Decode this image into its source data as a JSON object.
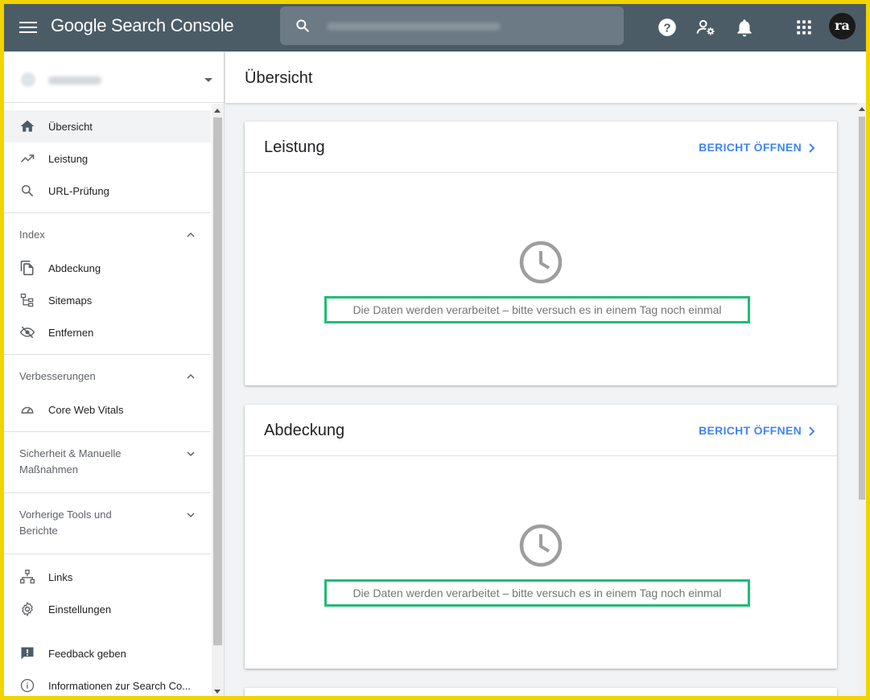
{
  "app": {
    "brand": "Google Search Console",
    "search_placeholder": "",
    "avatar_text": "ra"
  },
  "sidebar": {
    "items_top": [
      {
        "label": "Übersicht",
        "icon": "home-icon",
        "active": true
      },
      {
        "label": "Leistung",
        "icon": "trending-up-icon"
      },
      {
        "label": "URL-Prüfung",
        "icon": "search-icon"
      }
    ],
    "sections": [
      {
        "label": "Index",
        "expanded": true
      },
      {
        "label": "Verbesserungen",
        "expanded": true
      },
      {
        "label": "Sicherheit & Manuelle Maßnahmen",
        "line1": "Sicherheit & Manuelle",
        "line2": "Maßnahmen",
        "expanded": false
      },
      {
        "label": "Vorherige Tools und Berichte",
        "line1": "Vorherige Tools und",
        "line2": "Berichte",
        "expanded": false
      }
    ],
    "index_items": [
      {
        "label": "Abdeckung",
        "icon": "file-copy-icon"
      },
      {
        "label": "Sitemaps",
        "icon": "sitemap-icon"
      },
      {
        "label": "Entfernen",
        "icon": "visibility-off-icon"
      }
    ],
    "improvement_items": [
      {
        "label": "Core Web Vitals",
        "icon": "speedometer-icon"
      }
    ],
    "bottom_items": [
      {
        "label": "Links",
        "icon": "link-structure-icon"
      },
      {
        "label": "Einstellungen",
        "icon": "settings-icon"
      },
      {
        "label": "Feedback geben",
        "icon": "feedback-icon"
      },
      {
        "label": "Informationen zur Search Co...",
        "icon": "info-icon"
      }
    ]
  },
  "main": {
    "page_title": "Übersicht",
    "cards": [
      {
        "title": "Leistung",
        "action": "BERICHT ÖFFNEN",
        "message": "Die Daten werden verarbeitet – bitte versuch es in einem Tag noch einmal"
      },
      {
        "title": "Abdeckung",
        "action": "BERICHT ÖFFNEN",
        "message": "Die Daten werden verarbeitet – bitte versuch es in einem Tag noch einmal"
      }
    ]
  },
  "colors": {
    "topbar": "#4b5c67",
    "highlight_border": "#1ebd77",
    "link_blue": "#4285f4",
    "outer_frame": "#f1d400"
  }
}
